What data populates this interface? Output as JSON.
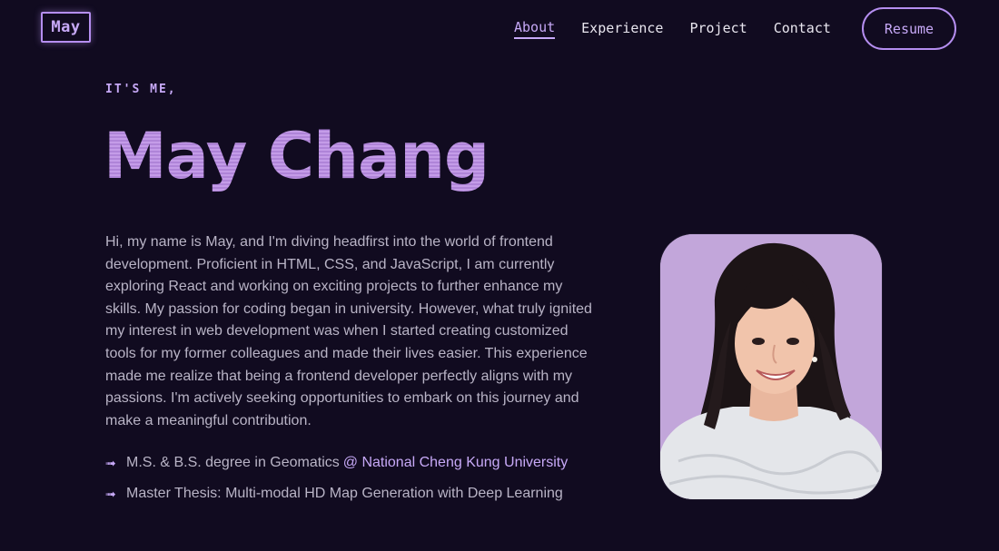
{
  "logo": {
    "text": "May"
  },
  "nav": {
    "items": [
      {
        "label": "About",
        "active": true
      },
      {
        "label": "Experience",
        "active": false
      },
      {
        "label": "Project",
        "active": false
      },
      {
        "label": "Contact",
        "active": false
      }
    ],
    "resume_label": "Resume"
  },
  "hero": {
    "kicker": "IT'S ME,",
    "name": "May Chang",
    "bio": "Hi, my name is May, and I'm diving headfirst into the world of frontend development. Proficient in HTML, CSS, and JavaScript, I am currently exploring React and working on exciting projects to further enhance my skills. My passion for coding began in university. However, what truly ignited my interest in web development was when I started creating customized tools for my former colleagues and made their lives easier. This experience made me realize that being a frontend developer perfectly aligns with my passions. I'm actively seeking opportunities to embark on this journey and make a meaningful contribution.",
    "education": [
      {
        "text": "M.S. & B.S. degree in Geomatics",
        "link": "@ National Cheng Kung University"
      },
      {
        "text": "Master Thesis: Multi-modal HD Map Generation with Deep Learning",
        "link": ""
      }
    ]
  },
  "colors": {
    "background": "#110b20",
    "accent": "#c7a9f7",
    "text": "#b9b4c6",
    "photo_bg": "#c2a6da"
  },
  "icons": {
    "bullet": "arrow-bullet-icon"
  }
}
